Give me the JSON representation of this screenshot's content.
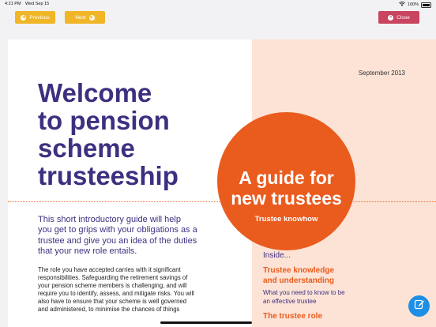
{
  "status": {
    "time": "4:21 PM",
    "date": "Wed Sep 15",
    "battery": "100%"
  },
  "toolbar": {
    "previous_label": "Previous",
    "next_label": "Next",
    "close_label": "Close",
    "colors": {
      "nav": "#f0b627",
      "close": "#c8445f"
    }
  },
  "document": {
    "date": "September 2013",
    "title_lines": [
      "Welcome",
      "to pension",
      "scheme",
      "trusteeship"
    ],
    "circle": {
      "line1": "A guide for",
      "line2": "new trustees",
      "subtitle": "Trustee knowhow"
    },
    "intro_lines": [
      "This short introductory guide will help",
      "you get to grips with your obligations as a",
      "trustee and give you an idea of the duties",
      "that your new role entails."
    ],
    "body_lines": [
      "The role you have accepted carries with it significant",
      "responsibilities. Safeguarding the retirement savings of",
      "your pension scheme members is challenging, and will",
      "require you to identify, assess, and mitigate risks. You will",
      "also have to ensure that your scheme is well governed",
      "and administered, to minimise the chances of things"
    ],
    "inside_label": "Inside...",
    "topic1_lines": [
      "Trustee knowledge",
      "and understanding"
    ],
    "topic1_sub_lines": [
      "What you need to know to be",
      "an effective trustee"
    ],
    "topic2_lines": [
      "The trustee role"
    ],
    "colors": {
      "title": "#3e2f80",
      "accent": "#ea5b1e",
      "panel": "#fce3d6"
    }
  },
  "fab": {
    "icon": "edit-note-icon",
    "color": "#1e8fe6"
  }
}
